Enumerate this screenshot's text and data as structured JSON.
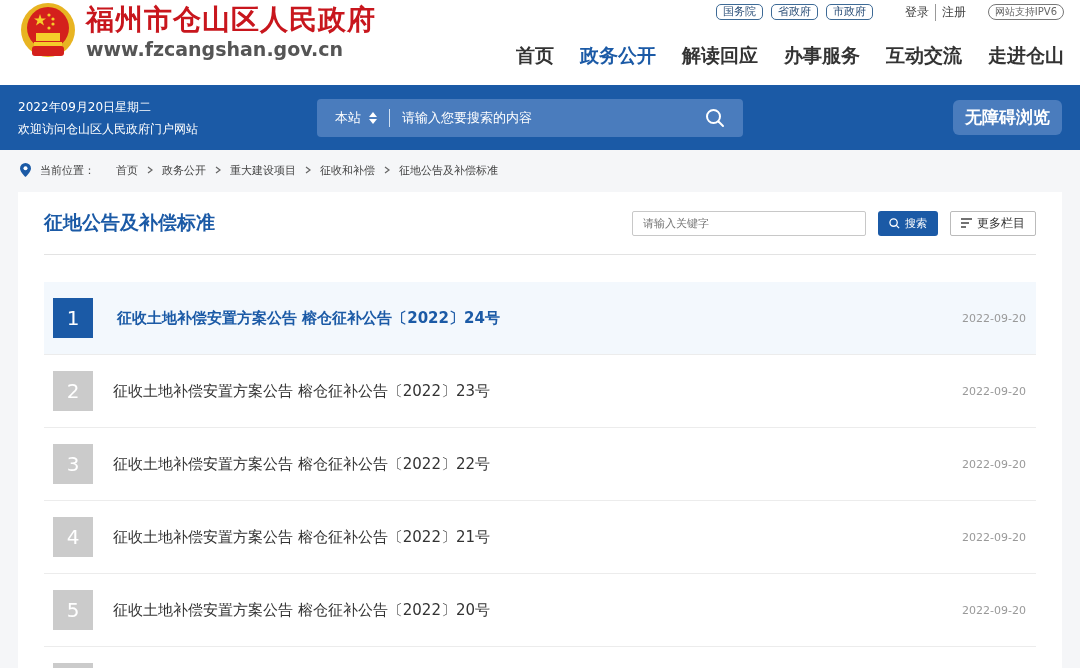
{
  "header": {
    "site_name": "福州市仓山区人民政府",
    "site_url": "www.fzcangshan.gov.cn",
    "gov_links": [
      "国务院",
      "省政府",
      "市政府"
    ],
    "account_links": [
      "登录",
      "注册"
    ],
    "ipv6_badge": "网站支持IPV6",
    "nav": [
      {
        "label": "首页",
        "selected": false
      },
      {
        "label": "政务公开",
        "selected": true
      },
      {
        "label": "解读回应",
        "selected": false
      },
      {
        "label": "办事服务",
        "selected": false
      },
      {
        "label": "互动交流",
        "selected": false
      },
      {
        "label": "走进仓山",
        "selected": false
      }
    ]
  },
  "info_bar": {
    "date": "2022年09月20日星期二",
    "welcome": "欢迎访问仓山区人民政府门户网站",
    "scope": "本站",
    "search_placeholder": "请输入您要搜索的内容",
    "accessibility_button": "无障碍浏览"
  },
  "breadcrumb": {
    "label": "当前位置：",
    "items": [
      "首页",
      "政务公开",
      "重大建设项目",
      "征收和补偿",
      "征地公告及补偿标准"
    ]
  },
  "panel": {
    "title": "征地公告及补偿标准",
    "keyword_placeholder": "请输入关键字",
    "search_button": "搜索",
    "more_button": "更多栏目",
    "rows": [
      {
        "number": "1",
        "title": "征收土地补偿安置方案公告 榕仓征补公告〔2022〕24号",
        "date": "2022-09-20",
        "selected": true
      },
      {
        "number": "2",
        "title": "征收土地补偿安置方案公告 榕仓征补公告〔2022〕23号",
        "date": "2022-09-20",
        "selected": false
      },
      {
        "number": "3",
        "title": "征收土地补偿安置方案公告 榕仓征补公告〔2022〕22号",
        "date": "2022-09-20",
        "selected": false
      },
      {
        "number": "4",
        "title": "征收土地补偿安置方案公告 榕仓征补公告〔2022〕21号",
        "date": "2022-09-20",
        "selected": false
      },
      {
        "number": "5",
        "title": "征收土地补偿安置方案公告 榕仓征补公告〔2022〕20号",
        "date": "2022-09-20",
        "selected": false
      }
    ]
  }
}
